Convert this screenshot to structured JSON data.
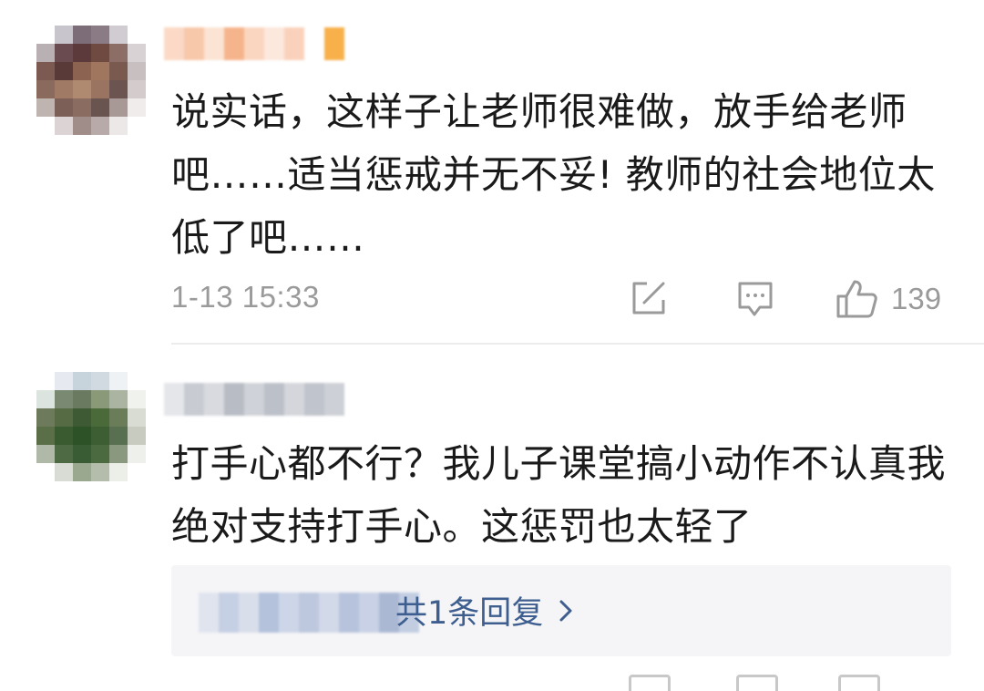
{
  "comments": [
    {
      "content": "说实话，这样子让老师很难做，放手给老师吧……适当惩戒并无不妥! 教师的社会地位太低了吧……",
      "timestamp": "1-13 15:33",
      "like_count": "139",
      "avatar_colors": [
        "#ffffff",
        "#c9c5cc",
        "#7d6d78",
        "#8a7b85",
        "#d0ccd2",
        "#ffffff",
        "#b8b0b2",
        "#6a4c50",
        "#5c3a3c",
        "#6e4a40",
        "#8c6e66",
        "#d8d2d4",
        "#7c5a52",
        "#5a3a38",
        "#8c6250",
        "#a0765e",
        "#7a5a4e",
        "#c8c0c0",
        "#8a6a5c",
        "#a07a64",
        "#b08a70",
        "#9a7460",
        "#6c5450",
        "#d4cccc",
        "#c0b4b0",
        "#7c6058",
        "#8a6c60",
        "#6a5450",
        "#a89896",
        "#f0ecec",
        "#ffffff",
        "#dcd4d4",
        "#a08c88",
        "#b8aaa8",
        "#ece8e8",
        "#ffffff"
      ],
      "username_colors": [
        "#fbd9c6",
        "#f7c8aa",
        "#fbe4d4",
        "#f6b48c",
        "#fad6c0",
        "#fce8dc",
        "#fad2bc",
        "#ffffff",
        "#f7b04a"
      ]
    },
    {
      "content": "打手心都不行？我儿子课堂搞小动作不认真我绝对支持打手心。这惩罚也太轻了",
      "reply_summary": "共1条回复",
      "avatar_colors": [
        "#ffffff",
        "#e6eaf0",
        "#c8d4dc",
        "#d0dae0",
        "#eef2f4",
        "#ffffff",
        "#dce4e0",
        "#7a8a72",
        "#6a7a60",
        "#8a9a78",
        "#aab4a0",
        "#f0f2ee",
        "#6e7a5c",
        "#566a44",
        "#3e5a34",
        "#4a6a3a",
        "#6a7c58",
        "#d8dcd2",
        "#5a6e48",
        "#3a5a30",
        "#2e5228",
        "#3c5e32",
        "#587050",
        "#c8ccc0",
        "#b0b8a8",
        "#4e6a44",
        "#3a5c34",
        "#4c6a40",
        "#8a9880",
        "#eef0ec",
        "#ffffff",
        "#d8dcd4",
        "#9aa890",
        "#b4bcac",
        "#eceee8",
        "#ffffff"
      ],
      "username_colors": [
        "#e4e6ea",
        "#c8ccd2",
        "#d8dadf",
        "#b8bcc4",
        "#cfd2d8",
        "#bcc0c8",
        "#d4d6dc",
        "#c0c4cc",
        "#cdd0d6"
      ],
      "reply_name_colors": [
        "#dfe4ef",
        "#c6d0e4",
        "#d8deea",
        "#b4c2dc",
        "#ccd6e8",
        "#bdc8de",
        "#d2d9e9",
        "#b7c3dc",
        "#c8d1e5",
        "#aab8d4",
        "#c2cde2"
      ]
    }
  ],
  "colors": {
    "text": "#1a1a1a",
    "meta": "#9a9a9a",
    "link": "#3d5e8f",
    "icon": "#9a9a9a",
    "reply_bg": "#f5f5f7"
  }
}
